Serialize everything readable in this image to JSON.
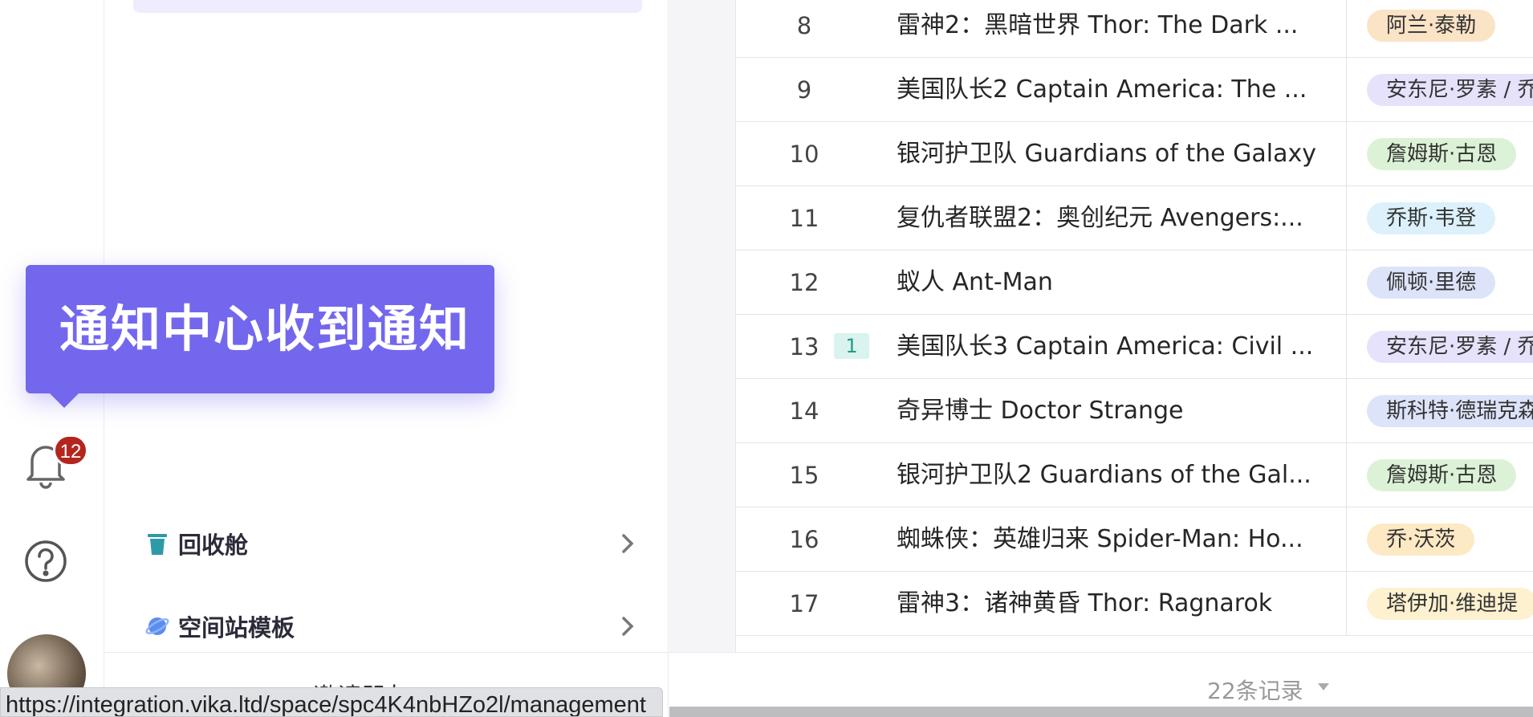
{
  "rail": {
    "notification_count": "12"
  },
  "sidebar": {
    "items": [
      {
        "label": "回收舱",
        "icon": "trash-icon"
      },
      {
        "label": "空间站模板",
        "icon": "planet-icon"
      }
    ],
    "invite_label": "邀请朋友"
  },
  "tooltip": {
    "text": "通知中心收到通知"
  },
  "table": {
    "rows": [
      {
        "num": "8",
        "title": "雷神2：黑暗世界 Thor: The Dark ...",
        "tag": "阿兰·泰勒",
        "tag_color": "#fbe3c6"
      },
      {
        "num": "9",
        "title": "美国队长2 Captain America: The ...",
        "tag": "安东尼·罗素 / 乔",
        "tag_color": "#e6e2fb"
      },
      {
        "num": "10",
        "title": "银河护卫队 Guardians of the Galaxy",
        "tag": "詹姆斯·古恩",
        "tag_color": "#dcf2d6"
      },
      {
        "num": "11",
        "title": "复仇者联盟2：奥创纪元 Avengers:...",
        "tag": "乔斯·韦登",
        "tag_color": "#dcf1fb"
      },
      {
        "num": "12",
        "title": "蚁人 Ant-Man",
        "tag": "佩顿·里德",
        "tag_color": "#dde4fa"
      },
      {
        "num": "13",
        "comments": "1",
        "title": "美国队长3 Captain America: Civil ...",
        "tag": "安东尼·罗素 / 乔",
        "tag_color": "#e6e2fb"
      },
      {
        "num": "14",
        "title": "奇异博士 Doctor Strange",
        "tag": "斯科特·德瑞克森",
        "tag_color": "#dde4fa"
      },
      {
        "num": "15",
        "title": "银河护卫队2 Guardians of the Gal...",
        "tag": "詹姆斯·古恩",
        "tag_color": "#dcf2d6"
      },
      {
        "num": "16",
        "title": "蜘蛛侠：英雄归来 Spider-Man: Ho...",
        "tag": "乔·沃茨",
        "tag_color": "#fde9c4"
      },
      {
        "num": "17",
        "title": "雷神3：诸神黄昏 Thor: Ragnarok",
        "tag": "塔伊加·维迪提",
        "tag_color": "#fdf1cf"
      }
    ]
  },
  "footer": {
    "record_count": "22条记录"
  },
  "status_url": "https://integration.vika.ltd/space/spc4K4nbHZo2l/management"
}
